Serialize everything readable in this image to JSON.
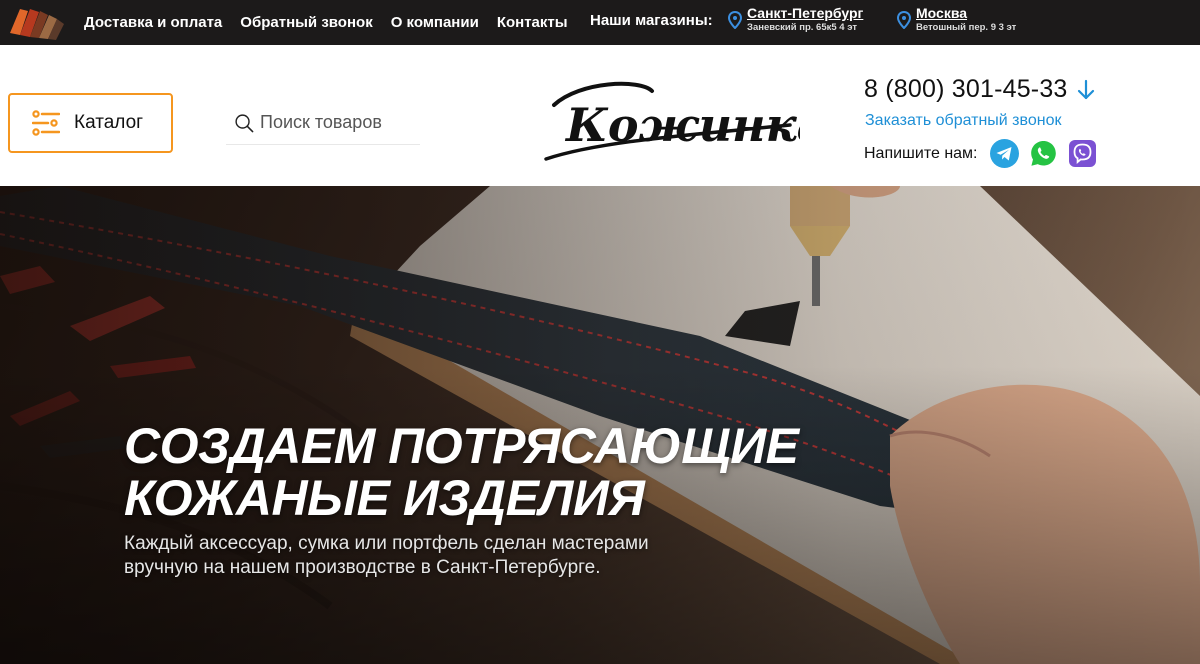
{
  "topbar": {
    "nav": [
      "Доставка и оплата",
      "Обратный звонок",
      "О компании",
      "Контакты"
    ],
    "stores_label": "Наши магазины:",
    "stores": [
      {
        "city": "Санкт-Петербург",
        "address": "Заневский пр. 65к5 4 эт"
      },
      {
        "city": "Москва",
        "address": "Ветошный пер. 9 3 эт"
      }
    ]
  },
  "header": {
    "catalog_label": "Каталог",
    "search_placeholder": "Поиск товаров",
    "brand": "Кожинка",
    "phone": "8 (800) 301-45-33",
    "callback_label": "Заказать обратный звонок",
    "write_us_label": "Напишите нам:",
    "messengers": [
      "telegram-icon",
      "whatsapp-icon",
      "viber-icon"
    ]
  },
  "hero": {
    "title_line1": "Создаем потрясающие",
    "title_line2": "кожаные изделия",
    "text": "Каждый аксессуар, сумка или портфель сделан мастерами вручную на нашем производстве в Санкт-Петербурге."
  },
  "colors": {
    "topbar_bg": "#1c1a1a",
    "accent_orange": "#f5961f",
    "link_blue": "#1e8fd6",
    "telegram": "#2aa3e0",
    "whatsapp": "#25c343",
    "viber": "#7b51d3"
  }
}
